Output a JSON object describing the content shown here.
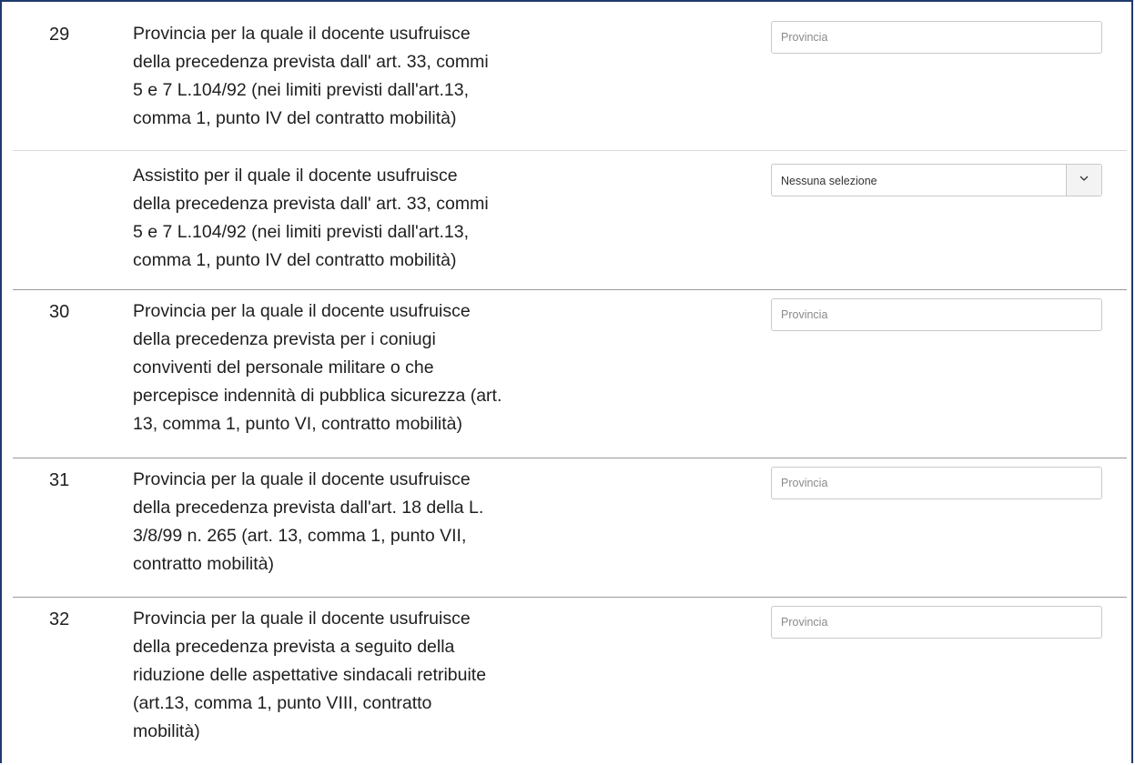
{
  "rows": [
    {
      "number": "29",
      "description": [
        "Provincia per la quale il docente usufruisce",
        "della precedenza prevista dall' art. 33, commi",
        "5 e 7 L.104/92 (nei limiti previsti dall'art.13,",
        "comma 1, punto IV del contratto mobilità)"
      ],
      "control": {
        "type": "input",
        "placeholder": "Provincia"
      }
    },
    {
      "number": "",
      "description": [
        "Assistito per il quale il docente usufruisce",
        "della precedenza prevista dall' art. 33, commi",
        "5 e 7 L.104/92 (nei limiti previsti dall'art.13,",
        "comma 1, punto IV del contratto mobilità)"
      ],
      "control": {
        "type": "select",
        "selected": "Nessuna selezione",
        "icon": "chevron-down-icon"
      }
    },
    {
      "number": "30",
      "description": [
        "Provincia per la quale il docente usufruisce",
        "della precedenza prevista per i coniugi",
        "conviventi del personale militare o che",
        "percepisce indennità di pubblica sicurezza (art.",
        "13, comma 1, punto VI, contratto mobilità)"
      ],
      "control": {
        "type": "input",
        "placeholder": "Provincia"
      }
    },
    {
      "number": "31",
      "description": [
        "Provincia per la quale il docente usufruisce",
        "della precedenza prevista dall'art. 18 della L.",
        "3/8/99 n. 265 (art. 13, comma 1, punto VII,",
        "contratto mobilità)"
      ],
      "control": {
        "type": "input",
        "placeholder": "Provincia"
      }
    },
    {
      "number": "32",
      "description": [
        "Provincia per la quale il docente usufruisce",
        "della precedenza prevista a seguito della",
        "riduzione delle aspettative sindacali retribuite",
        "(art.13, comma 1, punto VIII, contratto",
        "mobilità)"
      ],
      "control": {
        "type": "input",
        "placeholder": "Provincia"
      }
    }
  ],
  "colors": {
    "frame_border": "#1f3a6b",
    "text": "#1f1f1f",
    "field_border": "#c9c9c9"
  }
}
